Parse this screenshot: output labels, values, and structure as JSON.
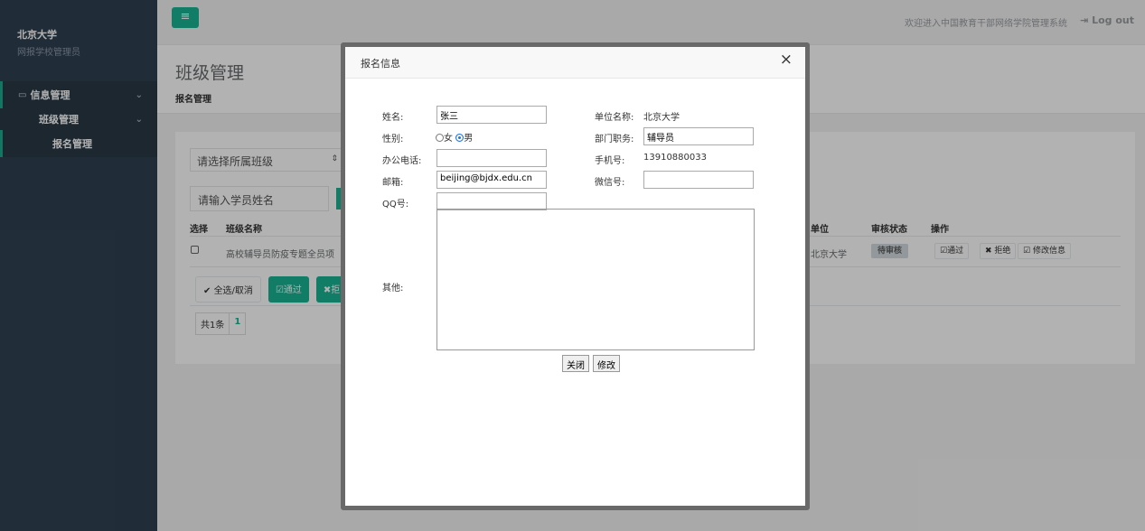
{
  "sidebar": {
    "org_name": "北京大学",
    "role": "网报学校管理员",
    "menu": {
      "info_mgmt": "信息管理",
      "class_mgmt": "班级管理",
      "signup_mgmt": "报名管理"
    }
  },
  "topbar": {
    "menu_icon": "≡",
    "welcome": "欢迎进入中国教育干部网络学院管理系统",
    "logout": "Log out"
  },
  "page": {
    "title": "班级管理",
    "breadcrumb": "报名管理"
  },
  "filters": {
    "class_select": "请选择所属班级",
    "search_placeholder": "请输入学员姓名"
  },
  "table": {
    "headers": {
      "select": "选择",
      "class_name": "班级名称",
      "unit": "单位",
      "status": "审核状态",
      "ops": "操作"
    },
    "rows": [
      {
        "class_name": "高校辅导员防疫专题全员项",
        "unit": "北京大学",
        "status": "待审核",
        "approve": "通过",
        "reject": "拒绝",
        "edit": "修改信息"
      }
    ]
  },
  "bulk_actions": {
    "select_all": "全选/取消",
    "approve": "通过",
    "reject": "拒"
  },
  "pager": {
    "total": "共1条",
    "current": "1"
  },
  "modal": {
    "title": "报名信息",
    "close_icon": "×",
    "fields": {
      "name_label": "姓名:",
      "name_value": "张三",
      "unit_label": "单位名称:",
      "unit_value": "北京大学",
      "gender_label": "性别:",
      "gender_female": "女",
      "gender_male": "男",
      "dept_label": "部门职务:",
      "dept_value": "辅导员",
      "office_phone_label": "办公电话:",
      "office_phone_value": "",
      "mobile_label": "手机号:",
      "mobile_value": "13910880033",
      "email_label": "邮箱:",
      "email_value": "beijing@bjdx.edu.cn",
      "wechat_label": "微信号:",
      "wechat_value": "",
      "qq_label": "QQ号:",
      "qq_value": "",
      "other_label": "其他:",
      "other_value": ""
    },
    "buttons": {
      "close": "关闭",
      "modify": "修改"
    }
  }
}
